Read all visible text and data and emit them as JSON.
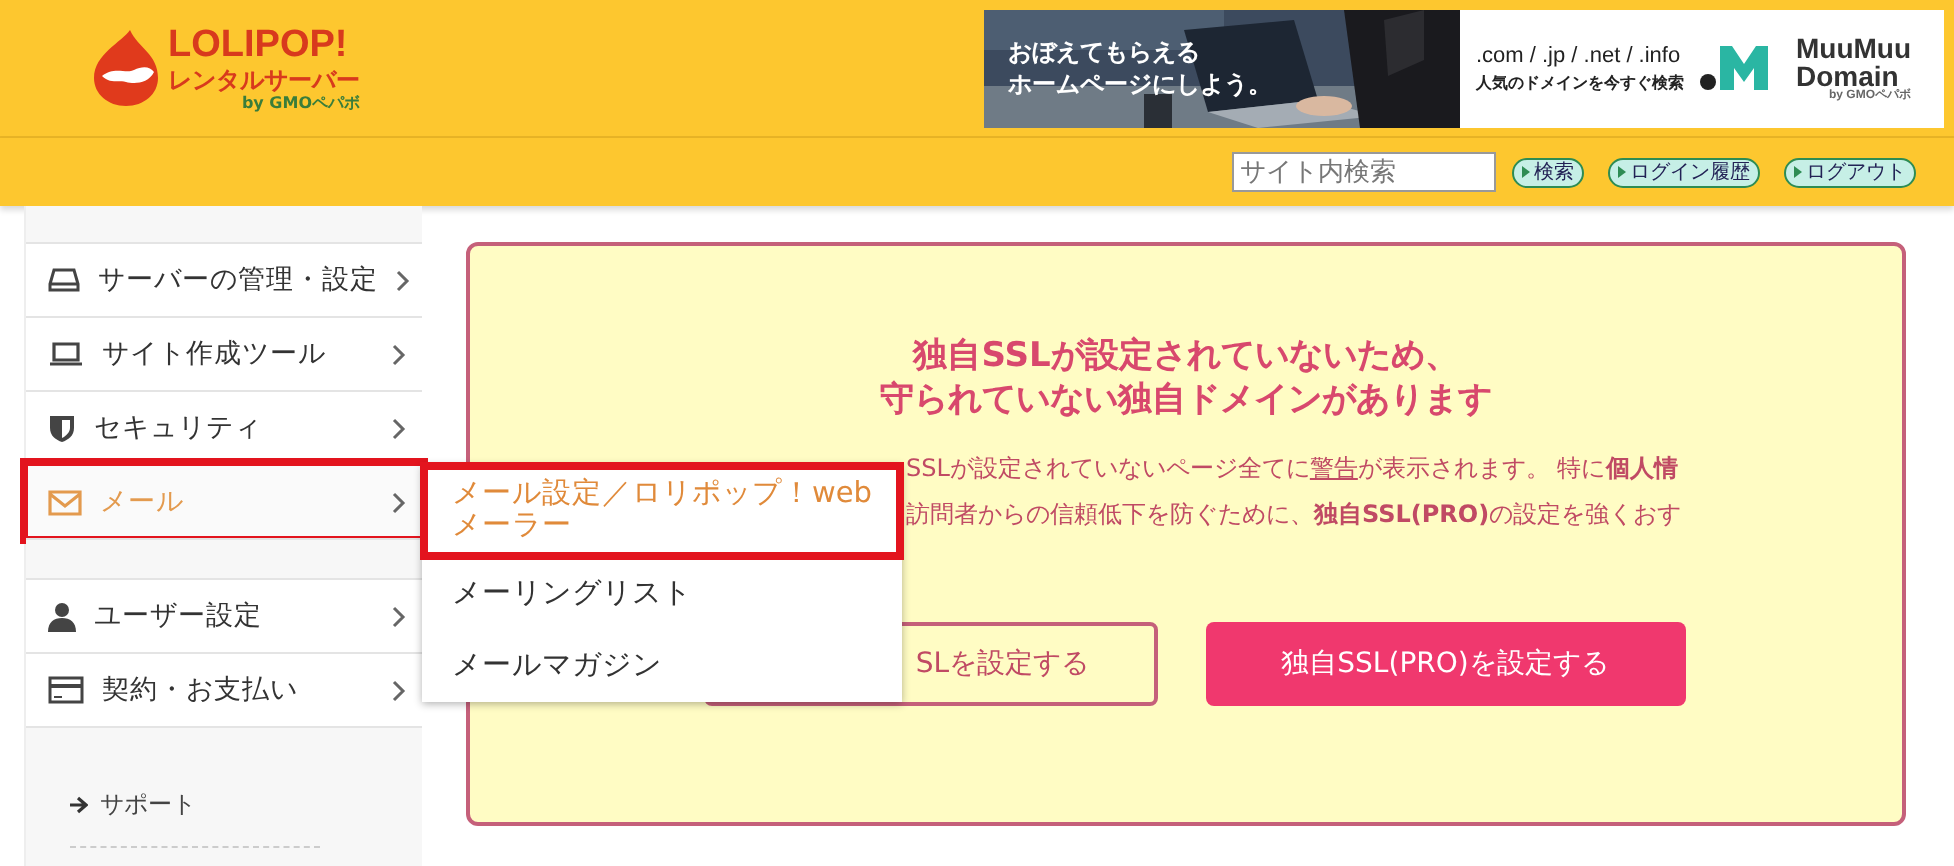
{
  "header": {
    "logo": {
      "name": "LOLIPOP!",
      "subtitle": "レンタルサーバー",
      "byline": "by GMOペパボ"
    },
    "banner": {
      "photo_text": [
        "おぼえてもらえる",
        "ホームページにしよう。"
      ],
      "domains": ".com / .jp / .net / .info",
      "tagline": "人気のドメインを今すぐ検索",
      "brand": [
        "MuuMuu",
        "Domain"
      ],
      "brand_byline": "by GMOペパボ"
    }
  },
  "toolbar": {
    "search": {
      "placeholder": "サイト内検索"
    },
    "buttons": [
      "検索",
      "ログイン履歴",
      "ログアウト"
    ]
  },
  "sidebar": {
    "items": [
      {
        "label": "サーバーの管理・設定",
        "selected": false,
        "highlighted": false
      },
      {
        "label": "サイト作成ツール",
        "selected": false,
        "highlighted": false
      },
      {
        "label": "セキュリティ",
        "selected": false,
        "highlighted": false
      },
      {
        "label": "メール",
        "selected": true,
        "highlighted": true
      },
      {
        "label": "ユーザー設定",
        "selected": false,
        "highlighted": false
      },
      {
        "label": "契約・お支払い",
        "selected": false,
        "highlighted": false
      }
    ],
    "support": "サポート"
  },
  "submenu": {
    "items": [
      {
        "label": "メール設定／ロリポップ！webメーラー",
        "selected": true,
        "highlighted": true
      },
      {
        "label": "メーリングリスト",
        "selected": false,
        "highlighted": false
      },
      {
        "label": "メールマガジン",
        "selected": false,
        "highlighted": false
      }
    ]
  },
  "notice": {
    "title": [
      "独自SSLが設定されていないため、",
      "守られていない独自ドメインがあります"
    ],
    "lines": [
      [
        {
          "text": "SSLが設定されていないページ全てに",
          "kind": "plain"
        },
        {
          "text": "警告",
          "kind": "link"
        },
        {
          "text": "が表示されます。 特に",
          "kind": "plain"
        },
        {
          "text": "個人情",
          "kind": "bold"
        }
      ],
      [
        {
          "text": "訪問者からの信頼低下を防ぐために、",
          "kind": "plain"
        },
        {
          "text": "独自SSL(PRO)",
          "kind": "bold"
        },
        {
          "text": "の設定を強くおす",
          "kind": "plain"
        }
      ]
    ],
    "buttons": [
      {
        "label": "SLを設定する",
        "kind": "outline"
      },
      {
        "label": "独自SSL(PRO)を設定する",
        "kind": "filled"
      }
    ]
  }
}
